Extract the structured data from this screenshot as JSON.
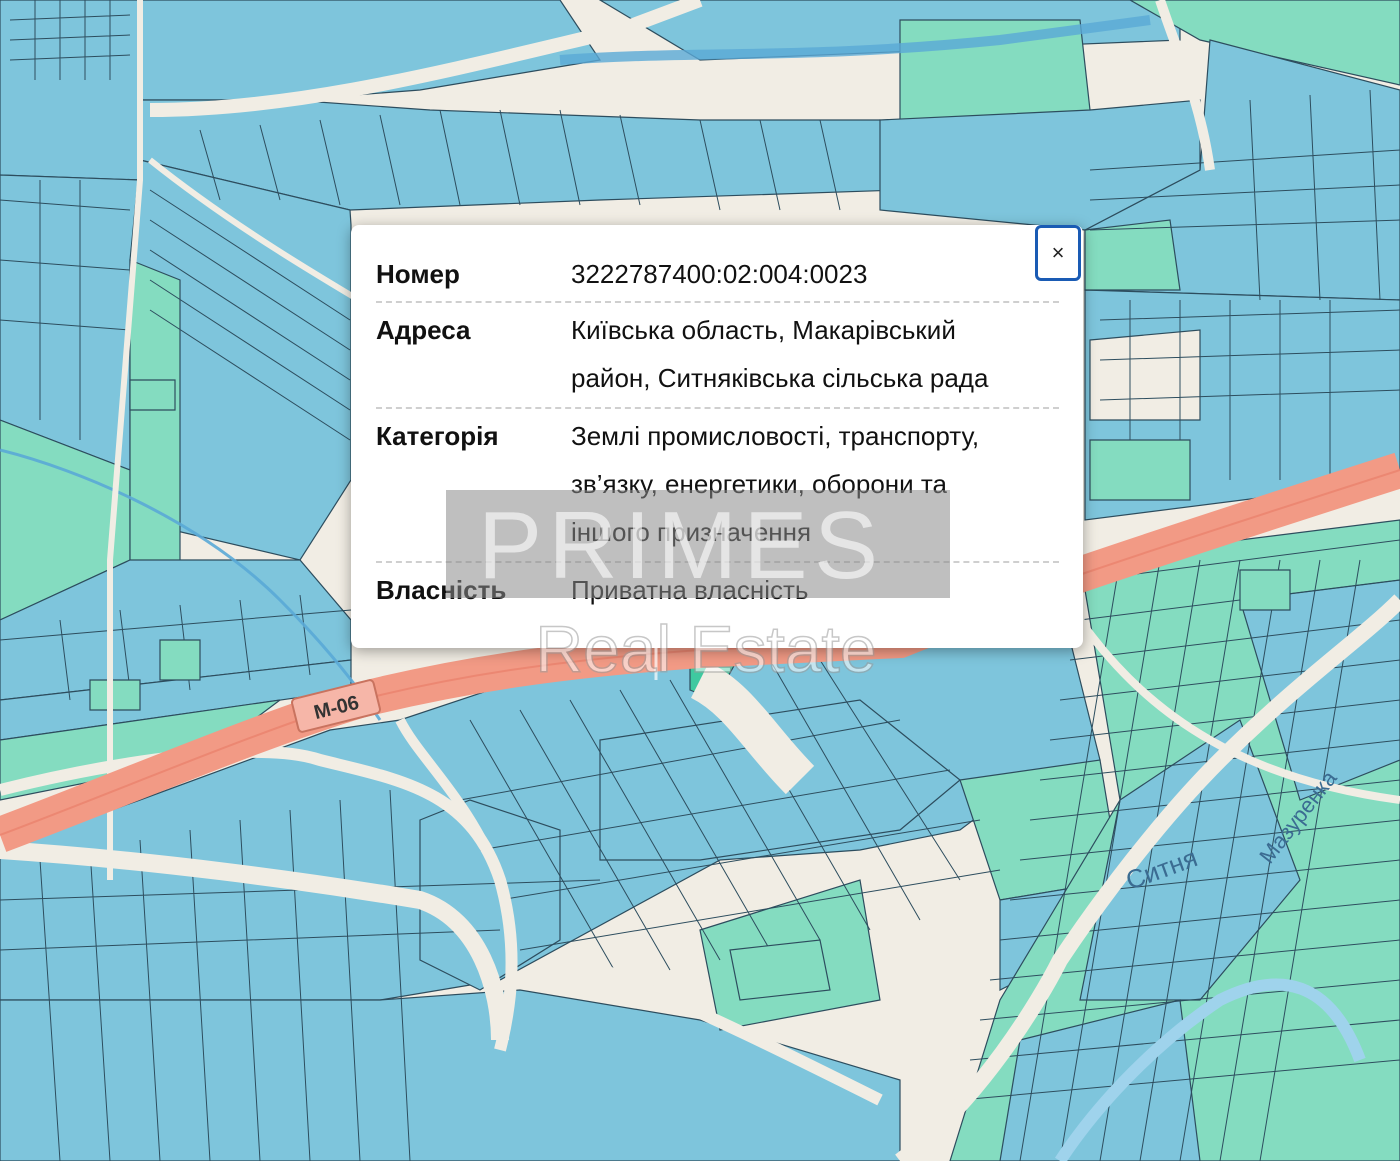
{
  "map": {
    "colors": {
      "parcel_blue": "#7ec5dc",
      "parcel_green": "#84dcc0",
      "parcel_dark_green": "#3fc9a0",
      "ground": "#f1ede4",
      "road": "#f29a85",
      "parcel_border": "#2d4d5e"
    },
    "road_shield": "М-06",
    "street_labels": [
      "Ситня",
      "Мазуренка"
    ]
  },
  "popup": {
    "close_label": "×",
    "rows": [
      {
        "key": "Номер",
        "value": "3222787400:02:004:0023"
      },
      {
        "key": "Адреса",
        "value_lines": [
          "Київська область, Макарівський",
          "район, Ситняківська сільська рада"
        ]
      },
      {
        "key": "Категорія",
        "value_lines": [
          "Землі промисловості, транспорту,",
          "зв’язку, енергетики, оборони та",
          "іншого призначення"
        ]
      },
      {
        "key": "Власність",
        "value": "Приватна власність"
      }
    ]
  },
  "watermark": {
    "brand": "PRIMES",
    "subtitle": "Real Estate"
  }
}
